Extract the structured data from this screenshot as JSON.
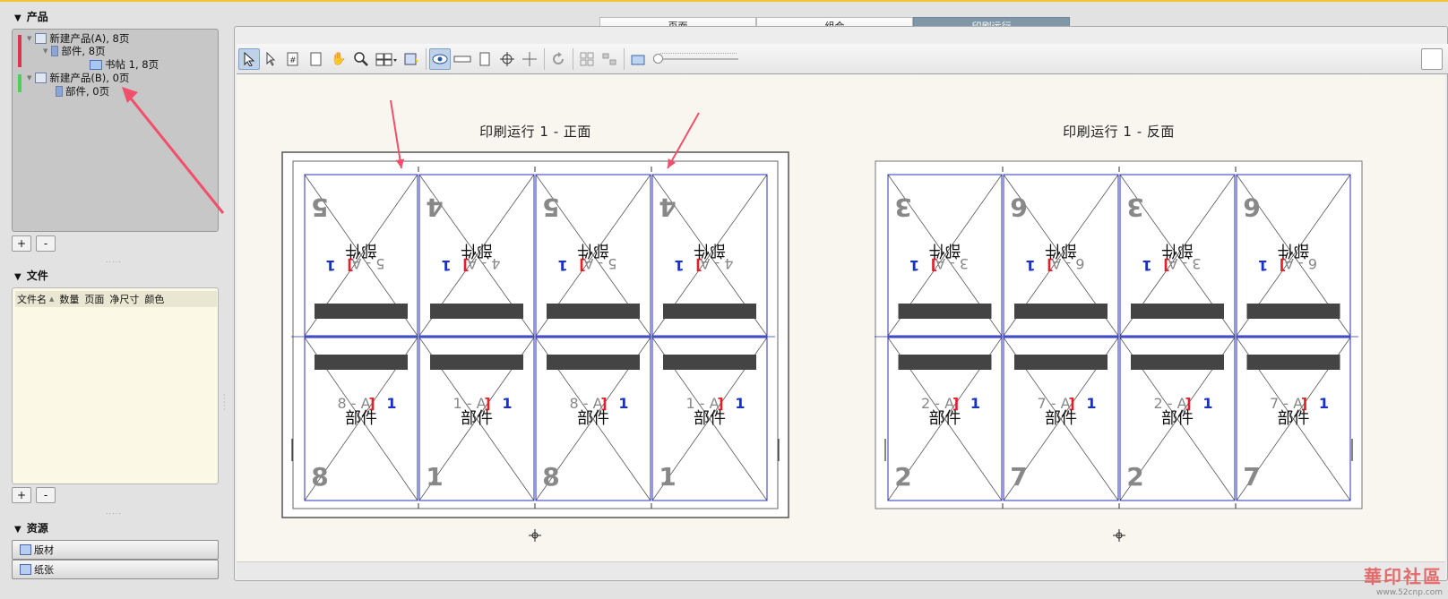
{
  "left": {
    "products_header": "产品",
    "product_tree": [
      {
        "label": "新建产品(A), 8页",
        "level": 0,
        "color": "#e0314f"
      },
      {
        "label": "部件, 8页",
        "level": 1
      },
      {
        "label": "书帖 1, 8页",
        "level": 2
      },
      {
        "label": "新建产品(B), 0页",
        "level": 0,
        "color": "#4cd05a"
      },
      {
        "label": "部件, 0页",
        "level": 1
      }
    ],
    "plus": "+",
    "minus": "-",
    "files_header": "文件",
    "file_columns": [
      "文件名",
      "数量",
      "页面",
      "净尺寸",
      "颜色"
    ],
    "resources_header": "资源",
    "resources": [
      "版材",
      "纸张"
    ]
  },
  "tabs": [
    {
      "label": "页面"
    },
    {
      "label": "组合"
    },
    {
      "label": "印刷运行"
    }
  ],
  "active_tab": 2,
  "sheets": [
    {
      "title": "印刷运行 1 - 正面",
      "top_folios": [
        "5",
        "4",
        "5",
        "4"
      ],
      "top_labels": [
        "5 - A",
        "4 - A",
        "5 - A",
        "4 - A"
      ],
      "bottom_folios": [
        "8",
        "1",
        "8",
        "1"
      ],
      "bottom_labels": [
        "8 - A",
        "1 - A",
        "8 - A",
        "1 - A"
      ],
      "part_name": "部件",
      "sig_no": "1"
    },
    {
      "title": "印刷运行 1 - 反面",
      "top_folios": [
        "3",
        "6",
        "3",
        "6"
      ],
      "top_labels": [
        "3 - A",
        "6 - A",
        "3 - A",
        "6 - A"
      ],
      "bottom_folios": [
        "2",
        "7",
        "2",
        "7"
      ],
      "bottom_labels": [
        "2 - A",
        "7 - A",
        "2 - A",
        "7 - A"
      ],
      "part_name": "部件",
      "sig_no": "1"
    }
  ],
  "watermark": {
    "text": "華印社區",
    "url": "www.52cnp.com"
  },
  "colors": {
    "accent_tab": "#7f97a9",
    "page_border": "#2a32b8",
    "red_mark": "#e0202a",
    "blue_mark": "#1830c8",
    "bar": "#444444"
  }
}
